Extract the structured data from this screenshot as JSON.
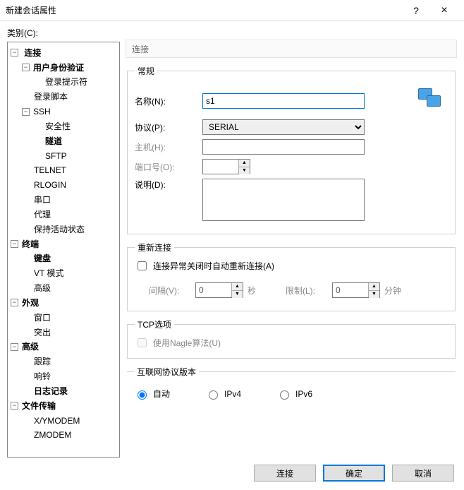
{
  "window": {
    "title": "新建会话属性",
    "help": "?",
    "close": "×"
  },
  "category_label": "类别(C):",
  "tree": {
    "connection": "连接",
    "user_auth": "用户身份验证",
    "login_prompt": "登录提示符",
    "login_script": "登录脚本",
    "ssh": "SSH",
    "security": "安全性",
    "tunnel": "隧道",
    "sftp": "SFTP",
    "telnet": "TELNET",
    "rlogin": "RLOGIN",
    "serial": "串口",
    "proxy": "代理",
    "keepalive": "保持活动状态",
    "terminal": "终端",
    "keyboard": "键盘",
    "vtmode": "VT 模式",
    "advanced_t": "高级",
    "appearance": "外观",
    "window": "窗口",
    "highlight": "突出",
    "advanced": "高级",
    "trace": "跟踪",
    "bell": "响铃",
    "log": "日志记录",
    "filetransfer": "文件传输",
    "xymodem": "X/YMODEM",
    "zmodem": "ZMODEM"
  },
  "header": "连接",
  "general": {
    "legend": "常规",
    "name_label": "名称(N):",
    "name_value": "s1",
    "proto_label": "协议(P):",
    "proto_value": "SERIAL",
    "host_label": "主机(H):",
    "host_value": "",
    "port_label": "端口号(O):",
    "port_value": "",
    "desc_label": "说明(D):",
    "desc_value": ""
  },
  "reconnect": {
    "legend": "重新连接",
    "chk_label": "连接异常关闭时自动重新连接(A)",
    "interval_label": "间隔(V):",
    "interval_value": "0",
    "interval_unit": "秒",
    "limit_label": "限制(L):",
    "limit_value": "0",
    "limit_unit": "分钟"
  },
  "tcp": {
    "legend": "TCP选项",
    "nagle_label": "使用Nagle算法(U)"
  },
  "ipver": {
    "legend": "互联网协议版本",
    "auto": "自动",
    "ipv4": "IPv4",
    "ipv6": "IPv6"
  },
  "footer": {
    "connect": "连接",
    "ok": "确定",
    "cancel": "取消"
  }
}
